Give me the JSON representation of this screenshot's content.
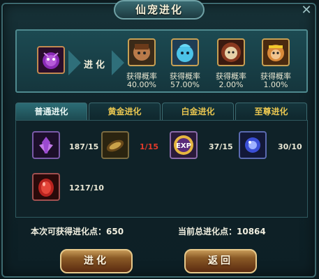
{
  "window": {
    "title": "仙宠进化"
  },
  "evolution": {
    "label": "进化",
    "results": [
      {
        "prob_label": "获得概率",
        "prob_value": "40.00%"
      },
      {
        "prob_label": "获得概率",
        "prob_value": "57.00%"
      },
      {
        "prob_label": "获得概率",
        "prob_value": "2.00%"
      },
      {
        "prob_label": "获得概率",
        "prob_value": "1.00%"
      }
    ]
  },
  "tabs": [
    {
      "label": "普通进化",
      "active": true
    },
    {
      "label": "黄金进化",
      "active": false
    },
    {
      "label": "白金进化",
      "active": false
    },
    {
      "label": "至尊进化",
      "active": false
    }
  ],
  "materials": [
    {
      "icon": "purple-crystal-icon",
      "count": "187/15",
      "color": "#e9e7d4"
    },
    {
      "icon": "golden-seed-icon",
      "count": "1/15",
      "color": "#e43a2a"
    },
    {
      "icon": "exp-orb-icon",
      "count": "37/15",
      "color": "#e9e7d4"
    },
    {
      "icon": "blue-spirit-stone-icon",
      "count": "30/10",
      "color": "#e9e7d4"
    },
    {
      "icon": "red-egg-icon",
      "count": "1217/10",
      "color": "#e9e7d4"
    }
  ],
  "points": {
    "obtainable": "本次可获得进化点：650",
    "total": "当前总进化点：10864"
  },
  "buttons": {
    "evolve": "进化",
    "back": "返回"
  }
}
